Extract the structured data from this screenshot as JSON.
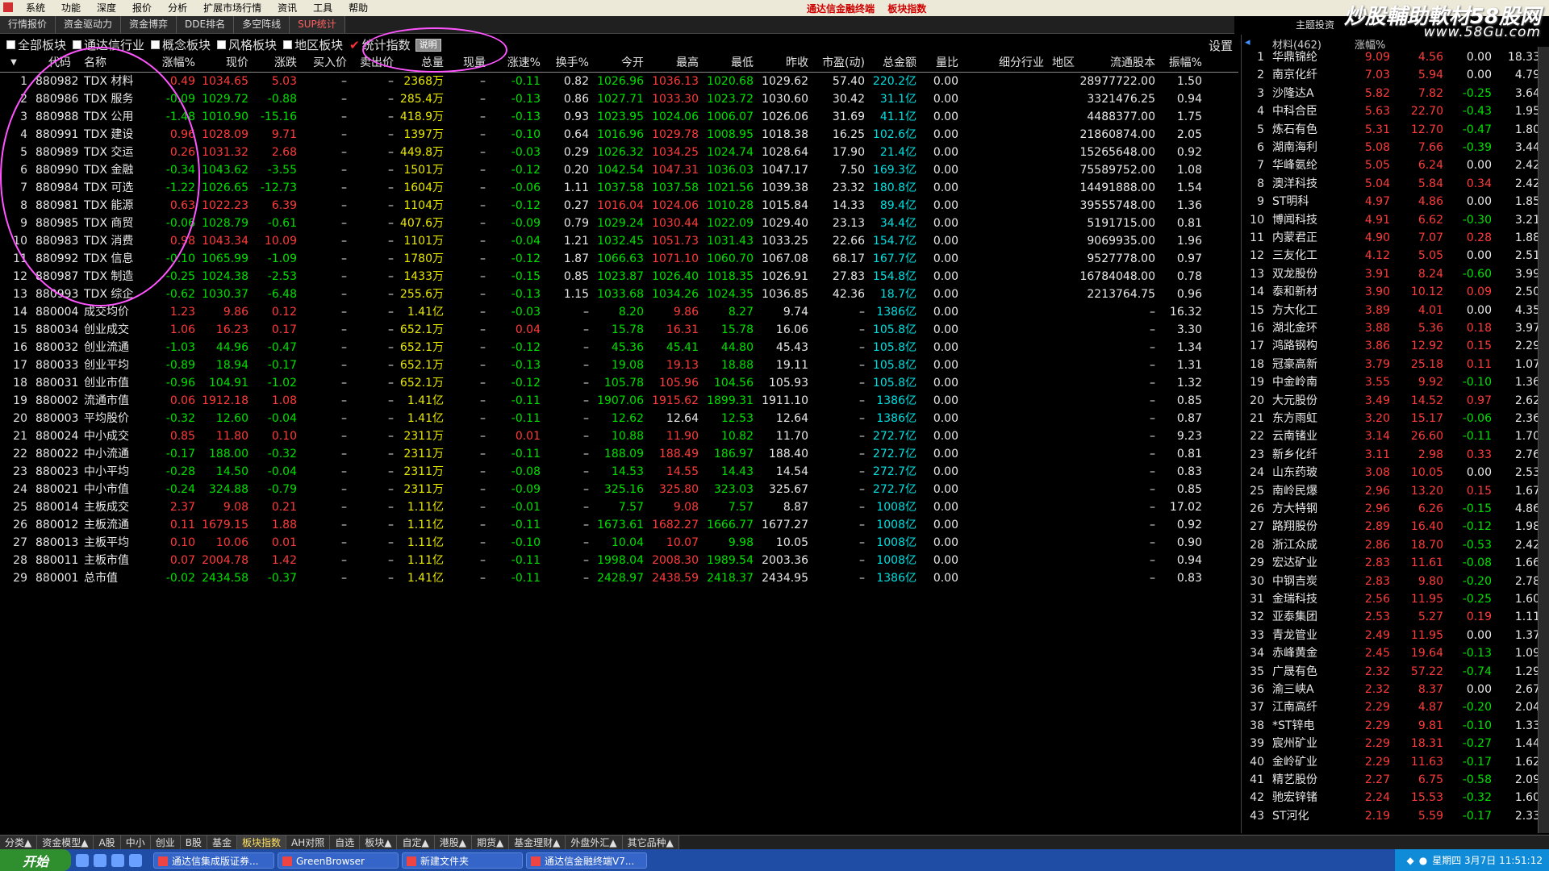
{
  "menubar": {
    "items": [
      "系统",
      "功能",
      "深度",
      "报价",
      "分析",
      "扩展市场行情",
      "资讯",
      "工具",
      "帮助"
    ],
    "title": "通达信金融终端",
    "subtitle": "板块指数"
  },
  "watermark": {
    "line1": "炒股輔助軟材58股网",
    "line2": "www.58Gu.com"
  },
  "functabs": [
    "行情报价",
    "资金驱动力",
    "资金博弈",
    "DDE排名",
    "多空阵线",
    "SUP统计"
  ],
  "functabs_selected": 5,
  "right_top_mini": "主题投资",
  "filters": {
    "items": [
      "全部板块",
      "通达信行业",
      "概念板块",
      "风格板块",
      "地区板块",
      "统计指数"
    ],
    "checked": "统计指数",
    "help_button": "说明",
    "settings": "设置"
  },
  "table": {
    "headers": [
      "代码",
      "名称",
      "涨幅%",
      "现价",
      "涨跌",
      "买入价",
      "卖出价",
      "总量",
      "现量",
      "涨速%",
      "换手%",
      "今开",
      "最高",
      "最低",
      "昨收",
      "市盈(动)",
      "总金额",
      "量比",
      "细分行业",
      "地区",
      "流通股本",
      "振幅%"
    ],
    "rows": [
      [
        "1",
        "880982",
        "TDX 材料",
        "0.49",
        "1034.65",
        "5.03",
        "–",
        "–",
        "2368万",
        "–",
        "-0.11",
        "0.82",
        "1026.96",
        "1036.13",
        "1020.68",
        "1029.62",
        "57.40",
        "220.2亿",
        "0.00",
        "",
        "",
        "28977722.00",
        "1.50"
      ],
      [
        "2",
        "880986",
        "TDX 服务",
        "-0.09",
        "1029.72",
        "-0.88",
        "–",
        "–",
        "285.4万",
        "–",
        "-0.13",
        "0.86",
        "1027.71",
        "1033.30",
        "1023.72",
        "1030.60",
        "30.42",
        "31.1亿",
        "0.00",
        "",
        "",
        "3321476.25",
        "0.94"
      ],
      [
        "3",
        "880988",
        "TDX 公用",
        "-1.48",
        "1010.90",
        "-15.16",
        "–",
        "–",
        "418.9万",
        "–",
        "-0.13",
        "0.93",
        "1023.95",
        "1024.06",
        "1006.07",
        "1026.06",
        "31.69",
        "41.1亿",
        "0.00",
        "",
        "",
        "4488377.00",
        "1.75"
      ],
      [
        "4",
        "880991",
        "TDX 建设",
        "0.96",
        "1028.09",
        "9.71",
        "–",
        "–",
        "1397万",
        "–",
        "-0.10",
        "0.64",
        "1016.96",
        "1029.78",
        "1008.95",
        "1018.38",
        "16.25",
        "102.6亿",
        "0.00",
        "",
        "",
        "21860874.00",
        "2.05"
      ],
      [
        "5",
        "880989",
        "TDX 交运",
        "0.26",
        "1031.32",
        "2.68",
        "–",
        "–",
        "449.8万",
        "–",
        "-0.03",
        "0.29",
        "1026.32",
        "1034.25",
        "1024.74",
        "1028.64",
        "17.90",
        "21.4亿",
        "0.00",
        "",
        "",
        "15265648.00",
        "0.92"
      ],
      [
        "6",
        "880990",
        "TDX 金融",
        "-0.34",
        "1043.62",
        "-3.55",
        "–",
        "–",
        "1501万",
        "–",
        "-0.12",
        "0.20",
        "1042.54",
        "1047.31",
        "1036.03",
        "1047.17",
        "7.50",
        "169.3亿",
        "0.00",
        "",
        "",
        "75589752.00",
        "1.08"
      ],
      [
        "7",
        "880984",
        "TDX 可选",
        "-1.22",
        "1026.65",
        "-12.73",
        "–",
        "–",
        "1604万",
        "–",
        "-0.06",
        "1.11",
        "1037.58",
        "1037.58",
        "1021.56",
        "1039.38",
        "23.32",
        "180.8亿",
        "0.00",
        "",
        "",
        "14491888.00",
        "1.54"
      ],
      [
        "8",
        "880981",
        "TDX 能源",
        "0.63",
        "1022.23",
        "6.39",
        "–",
        "–",
        "1104万",
        "–",
        "-0.12",
        "0.27",
        "1016.04",
        "1024.06",
        "1010.28",
        "1015.84",
        "14.33",
        "89.4亿",
        "0.00",
        "",
        "",
        "39555748.00",
        "1.36"
      ],
      [
        "9",
        "880985",
        "TDX 商贸",
        "-0.06",
        "1028.79",
        "-0.61",
        "–",
        "–",
        "407.6万",
        "–",
        "-0.09",
        "0.79",
        "1029.24",
        "1030.44",
        "1022.09",
        "1029.40",
        "23.13",
        "34.4亿",
        "0.00",
        "",
        "",
        "5191715.00",
        "0.81"
      ],
      [
        "10",
        "880983",
        "TDX 消费",
        "0.98",
        "1043.34",
        "10.09",
        "–",
        "–",
        "1101万",
        "–",
        "-0.04",
        "1.21",
        "1032.45",
        "1051.73",
        "1031.43",
        "1033.25",
        "22.66",
        "154.7亿",
        "0.00",
        "",
        "",
        "9069935.00",
        "1.96"
      ],
      [
        "11",
        "880992",
        "TDX 信息",
        "-0.10",
        "1065.99",
        "-1.09",
        "–",
        "–",
        "1780万",
        "–",
        "-0.12",
        "1.87",
        "1066.63",
        "1071.10",
        "1060.70",
        "1067.08",
        "68.17",
        "167.7亿",
        "0.00",
        "",
        "",
        "9527778.00",
        "0.97"
      ],
      [
        "12",
        "880987",
        "TDX 制造",
        "-0.25",
        "1024.38",
        "-2.53",
        "–",
        "–",
        "1433万",
        "–",
        "-0.15",
        "0.85",
        "1023.87",
        "1026.40",
        "1018.35",
        "1026.91",
        "27.83",
        "154.8亿",
        "0.00",
        "",
        "",
        "16784048.00",
        "0.78"
      ],
      [
        "13",
        "880993",
        "TDX 综企",
        "-0.62",
        "1030.37",
        "-6.48",
        "–",
        "–",
        "255.6万",
        "–",
        "-0.13",
        "1.15",
        "1033.68",
        "1034.26",
        "1024.35",
        "1036.85",
        "42.36",
        "18.7亿",
        "0.00",
        "",
        "",
        "2213764.75",
        "0.96"
      ],
      [
        "14",
        "880004",
        "成交均价",
        "1.23",
        "9.86",
        "0.12",
        "–",
        "–",
        "1.41亿",
        "–",
        "-0.03",
        "–",
        "8.20",
        "9.86",
        "8.27",
        "9.74",
        "–",
        "1386亿",
        "0.00",
        "",
        "",
        "–",
        "16.32"
      ],
      [
        "15",
        "880034",
        "创业成交",
        "1.06",
        "16.23",
        "0.17",
        "–",
        "–",
        "652.1万",
        "–",
        "0.04",
        "–",
        "15.78",
        "16.31",
        "15.78",
        "16.06",
        "–",
        "105.8亿",
        "0.00",
        "",
        "",
        "–",
        "3.30"
      ],
      [
        "16",
        "880032",
        "创业流通",
        "-1.03",
        "44.96",
        "-0.47",
        "–",
        "–",
        "652.1万",
        "–",
        "-0.12",
        "–",
        "45.36",
        "45.41",
        "44.80",
        "45.43",
        "–",
        "105.8亿",
        "0.00",
        "",
        "",
        "–",
        "1.34"
      ],
      [
        "17",
        "880033",
        "创业平均",
        "-0.89",
        "18.94",
        "-0.17",
        "–",
        "–",
        "652.1万",
        "–",
        "-0.13",
        "–",
        "19.08",
        "19.13",
        "18.88",
        "19.11",
        "–",
        "105.8亿",
        "0.00",
        "",
        "",
        "–",
        "1.31"
      ],
      [
        "18",
        "880031",
        "创业市值",
        "-0.96",
        "104.91",
        "-1.02",
        "–",
        "–",
        "652.1万",
        "–",
        "-0.12",
        "–",
        "105.78",
        "105.96",
        "104.56",
        "105.93",
        "–",
        "105.8亿",
        "0.00",
        "",
        "",
        "–",
        "1.32"
      ],
      [
        "19",
        "880002",
        "流通市值",
        "0.06",
        "1912.18",
        "1.08",
        "–",
        "–",
        "1.41亿",
        "–",
        "-0.11",
        "–",
        "1907.06",
        "1915.62",
        "1899.31",
        "1911.10",
        "–",
        "1386亿",
        "0.00",
        "",
        "",
        "–",
        "0.85"
      ],
      [
        "20",
        "880003",
        "平均股价",
        "-0.32",
        "12.60",
        "-0.04",
        "–",
        "–",
        "1.41亿",
        "–",
        "-0.11",
        "–",
        "12.62",
        "12.64",
        "12.53",
        "12.64",
        "–",
        "1386亿",
        "0.00",
        "",
        "",
        "–",
        "0.87"
      ],
      [
        "21",
        "880024",
        "中小成交",
        "0.85",
        "11.80",
        "0.10",
        "–",
        "–",
        "2311万",
        "–",
        "0.01",
        "–",
        "10.88",
        "11.90",
        "10.82",
        "11.70",
        "–",
        "272.7亿",
        "0.00",
        "",
        "",
        "–",
        "9.23"
      ],
      [
        "22",
        "880022",
        "中小流通",
        "-0.17",
        "188.00",
        "-0.32",
        "–",
        "–",
        "2311万",
        "–",
        "-0.11",
        "–",
        "188.09",
        "188.49",
        "186.97",
        "188.40",
        "–",
        "272.7亿",
        "0.00",
        "",
        "",
        "–",
        "0.81"
      ],
      [
        "23",
        "880023",
        "中小平均",
        "-0.28",
        "14.50",
        "-0.04",
        "–",
        "–",
        "2311万",
        "–",
        "-0.08",
        "–",
        "14.53",
        "14.55",
        "14.43",
        "14.54",
        "–",
        "272.7亿",
        "0.00",
        "",
        "",
        "–",
        "0.83"
      ],
      [
        "24",
        "880021",
        "中小市值",
        "-0.24",
        "324.88",
        "-0.79",
        "–",
        "–",
        "2311万",
        "–",
        "-0.09",
        "–",
        "325.16",
        "325.80",
        "323.03",
        "325.67",
        "–",
        "272.7亿",
        "0.00",
        "",
        "",
        "–",
        "0.85"
      ],
      [
        "25",
        "880014",
        "主板成交",
        "2.37",
        "9.08",
        "0.21",
        "–",
        "–",
        "1.11亿",
        "–",
        "-0.01",
        "–",
        "7.57",
        "9.08",
        "7.57",
        "8.87",
        "–",
        "1008亿",
        "0.00",
        "",
        "",
        "–",
        "17.02"
      ],
      [
        "26",
        "880012",
        "主板流通",
        "0.11",
        "1679.15",
        "1.88",
        "–",
        "–",
        "1.11亿",
        "–",
        "-0.11",
        "–",
        "1673.61",
        "1682.27",
        "1666.77",
        "1677.27",
        "–",
        "1008亿",
        "0.00",
        "",
        "",
        "–",
        "0.92"
      ],
      [
        "27",
        "880013",
        "主板平均",
        "0.10",
        "10.06",
        "0.01",
        "–",
        "–",
        "1.11亿",
        "–",
        "-0.10",
        "–",
        "10.04",
        "10.07",
        "9.98",
        "10.05",
        "–",
        "1008亿",
        "0.00",
        "",
        "",
        "–",
        "0.90"
      ],
      [
        "28",
        "880011",
        "主板市值",
        "0.07",
        "2004.78",
        "1.42",
        "–",
        "–",
        "1.11亿",
        "–",
        "-0.11",
        "–",
        "1998.04",
        "2008.30",
        "1989.54",
        "2003.36",
        "–",
        "1008亿",
        "0.00",
        "",
        "",
        "–",
        "0.94"
      ],
      [
        "29",
        "880001",
        "总市值",
        "-0.02",
        "2434.58",
        "-0.37",
        "–",
        "–",
        "1.41亿",
        "–",
        "-0.11",
        "–",
        "2428.97",
        "2438.59",
        "2418.37",
        "2434.95",
        "–",
        "1386亿",
        "0.00",
        "",
        "",
        "–",
        "0.83"
      ]
    ]
  },
  "right_panel": {
    "header": [
      "材料(462)",
      "涨幅%"
    ],
    "rows": [
      [
        "1",
        "华鼎锦纶",
        "9.09",
        "4.56",
        "0.00",
        "18.33"
      ],
      [
        "2",
        "南京化纤",
        "7.03",
        "5.94",
        "0.00",
        "4.79"
      ],
      [
        "3",
        "沙隆达A",
        "5.82",
        "7.82",
        "-0.25",
        "3.64"
      ],
      [
        "4",
        "中科合臣",
        "5.63",
        "22.70",
        "-0.43",
        "1.95"
      ],
      [
        "5",
        "炼石有色",
        "5.31",
        "12.70",
        "-0.47",
        "1.80"
      ],
      [
        "6",
        "湖南海利",
        "5.08",
        "7.66",
        "-0.39",
        "3.44"
      ],
      [
        "7",
        "华峰氨纶",
        "5.05",
        "6.24",
        "0.00",
        "2.42"
      ],
      [
        "8",
        "澳洋科技",
        "5.04",
        "5.84",
        "0.34",
        "2.42"
      ],
      [
        "9",
        "ST明科",
        "4.97",
        "4.86",
        "0.00",
        "1.85"
      ],
      [
        "10",
        "博闻科技",
        "4.91",
        "6.62",
        "-0.30",
        "3.21"
      ],
      [
        "11",
        "内蒙君正",
        "4.90",
        "7.07",
        "0.28",
        "1.88"
      ],
      [
        "12",
        "三友化工",
        "4.12",
        "5.05",
        "0.00",
        "2.51"
      ],
      [
        "13",
        "双龙股份",
        "3.91",
        "8.24",
        "-0.60",
        "3.99"
      ],
      [
        "14",
        "泰和新材",
        "3.90",
        "10.12",
        "0.09",
        "2.50"
      ],
      [
        "15",
        "方大化工",
        "3.89",
        "4.01",
        "0.00",
        "4.35"
      ],
      [
        "16",
        "湖北金环",
        "3.88",
        "5.36",
        "0.18",
        "3.97"
      ],
      [
        "17",
        "鸿路钢构",
        "3.86",
        "12.92",
        "0.15",
        "2.29"
      ],
      [
        "18",
        "冠豪高新",
        "3.79",
        "25.18",
        "0.11",
        "1.07"
      ],
      [
        "19",
        "中金岭南",
        "3.55",
        "9.92",
        "-0.10",
        "1.36"
      ],
      [
        "20",
        "大元股份",
        "3.49",
        "14.52",
        "0.97",
        "2.62"
      ],
      [
        "21",
        "东方雨虹",
        "3.20",
        "15.17",
        "-0.06",
        "2.36"
      ],
      [
        "22",
        "云南锗业",
        "3.14",
        "26.60",
        "-0.11",
        "1.70"
      ],
      [
        "23",
        "新乡化纤",
        "3.11",
        "2.98",
        "0.33",
        "2.76"
      ],
      [
        "24",
        "山东药玻",
        "3.08",
        "10.05",
        "0.00",
        "2.53"
      ],
      [
        "25",
        "南岭民爆",
        "2.96",
        "13.20",
        "0.15",
        "1.67"
      ],
      [
        "26",
        "方大特钢",
        "2.96",
        "6.26",
        "-0.15",
        "4.86"
      ],
      [
        "27",
        "路翔股份",
        "2.89",
        "16.40",
        "-0.12",
        "1.98"
      ],
      [
        "28",
        "浙江众成",
        "2.86",
        "18.70",
        "-0.53",
        "2.42"
      ],
      [
        "29",
        "宏达矿业",
        "2.83",
        "11.61",
        "-0.08",
        "1.66"
      ],
      [
        "30",
        "中钢吉炭",
        "2.83",
        "9.80",
        "-0.20",
        "2.78"
      ],
      [
        "31",
        "金瑞科技",
        "2.56",
        "11.95",
        "-0.25",
        "1.60"
      ],
      [
        "32",
        "亚泰集团",
        "2.53",
        "5.27",
        "0.19",
        "1.11"
      ],
      [
        "33",
        "青龙管业",
        "2.49",
        "11.95",
        "0.00",
        "1.37"
      ],
      [
        "34",
        "赤峰黄金",
        "2.45",
        "19.64",
        "-0.13",
        "1.09"
      ],
      [
        "35",
        "广晟有色",
        "2.32",
        "57.22",
        "-0.74",
        "1.29"
      ],
      [
        "36",
        "渝三峡A",
        "2.32",
        "8.37",
        "0.00",
        "2.67"
      ],
      [
        "37",
        "江南高纤",
        "2.29",
        "4.87",
        "-0.20",
        "2.04"
      ],
      [
        "38",
        "*ST锌电",
        "2.29",
        "9.81",
        "-0.10",
        "1.33"
      ],
      [
        "39",
        "宸州矿业",
        "2.29",
        "18.31",
        "-0.27",
        "1.44"
      ],
      [
        "40",
        "金岭矿业",
        "2.29",
        "11.63",
        "-0.17",
        "1.62"
      ],
      [
        "41",
        "精艺股份",
        "2.27",
        "6.75",
        "-0.58",
        "2.09"
      ],
      [
        "42",
        "驰宏锌锗",
        "2.24",
        "15.53",
        "-0.32",
        "1.60"
      ],
      [
        "43",
        "ST河化",
        "2.19",
        "5.59",
        "-0.17",
        "2.33"
      ]
    ]
  },
  "bottom_tabs": [
    "分类▲",
    "资金模型▲",
    "A股",
    "中小",
    "创业",
    "B股",
    "基金",
    "板块指数",
    "AH对照",
    "自选",
    "板块▲",
    "自定▲",
    "港股▲",
    "期货▲",
    "基金理财▲",
    "外盘外汇▲",
    "其它品种▲"
  ],
  "bottom_tabs_selected": 7,
  "taskbar": {
    "start": "开始",
    "tasks": [
      "通达信集成版证券...",
      "GreenBrowser",
      "新建文件夹",
      "通达信金融终端V7..."
    ],
    "clock": "星期四 3月7日 11:51:12"
  },
  "colors": {
    "up": "#ff3b3b",
    "down": "#00e000",
    "flat": "#e8e8e8",
    "volume": "#e8e800",
    "amount": "#00e0e0",
    "circle": "#ff55ff"
  }
}
